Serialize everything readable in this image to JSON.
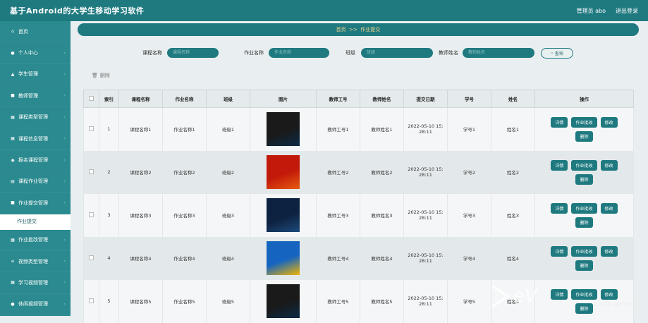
{
  "header": {
    "title": "基于Android的大学生移动学习软件",
    "user": "管理员 abo",
    "logout": "退出登录"
  },
  "sidebar": {
    "items": [
      {
        "label": "首页",
        "icon": "home-icon",
        "glyph": "⌂"
      },
      {
        "label": "个人中心",
        "icon": "user-icon",
        "glyph": "●"
      },
      {
        "label": "学生管理",
        "icon": "bank-icon",
        "glyph": "▲"
      },
      {
        "label": "教师管理",
        "icon": "doc-icon",
        "glyph": "■"
      },
      {
        "label": "课程类型管理",
        "icon": "grid-icon",
        "glyph": "▦"
      },
      {
        "label": "课程信息管理",
        "icon": "grid-icon",
        "glyph": "▦"
      },
      {
        "label": "报名课程管理",
        "icon": "disc-icon",
        "glyph": "◉"
      },
      {
        "label": "课程作业管理",
        "icon": "list-icon",
        "glyph": "▤"
      },
      {
        "label": "作业提交管理",
        "icon": "file-icon",
        "glyph": "■"
      },
      {
        "label": "作业提交",
        "sub": true
      },
      {
        "label": "作业批改管理",
        "icon": "grid-icon",
        "glyph": "▦"
      },
      {
        "label": "视频类型管理",
        "icon": "menu-icon",
        "glyph": "≡"
      },
      {
        "label": "学习视频管理",
        "icon": "grid-icon",
        "glyph": "▦"
      },
      {
        "label": "休闲视频管理",
        "icon": "user-icon",
        "glyph": "●"
      }
    ]
  },
  "breadcrumb": {
    "text": "首页  >>  作业提交"
  },
  "search": {
    "course_label": "课程名称",
    "course_ph": "课程名称",
    "hw_label": "作业名称",
    "hw_ph": "作业名称",
    "class_label": "班级",
    "class_ph": "班级",
    "teacher_label": "教师姓名",
    "teacher_ph": "教师姓名",
    "button": "查询"
  },
  "toolbar": {
    "delete": "删除"
  },
  "table": {
    "headers": [
      "索引",
      "课程名称",
      "作业名称",
      "班级",
      "图片",
      "教师工号",
      "教师姓名",
      "提交日期",
      "学号",
      "姓名",
      "操作"
    ],
    "rows": [
      {
        "idx": "1",
        "course": "课程名称1",
        "hw": "作业名称1",
        "cls": "班级1",
        "tno": "教师工号1",
        "tname": "教师姓名1",
        "date": "2022-05-10 15:\n28:11",
        "sno": "学号1",
        "sname": "姓名1",
        "img": "#1a1a1a",
        "img2": "#0b2a45"
      },
      {
        "idx": "2",
        "course": "课程名称2",
        "hw": "作业名称2",
        "cls": "班级2",
        "tno": "教师工号2",
        "tname": "教师姓名2",
        "date": "2022-05-10 15:\n28:11",
        "sno": "学号2",
        "sname": "姓名2",
        "img": "#c21a0a",
        "img2": "#e65a10"
      },
      {
        "idx": "3",
        "course": "课程名称3",
        "hw": "作业名称3",
        "cls": "班级3",
        "tno": "教师工号3",
        "tname": "教师姓名3",
        "date": "2022-05-10 15:\n28:11",
        "sno": "学号3",
        "sname": "姓名3",
        "img": "#0d2140",
        "img2": "#1d4a7a"
      },
      {
        "idx": "4",
        "course": "课程名称4",
        "hw": "作业名称4",
        "cls": "班级4",
        "tno": "教师工号4",
        "tname": "教师姓名4",
        "date": "2022-05-10 15:\n28:11",
        "sno": "学号4",
        "sname": "姓名4",
        "img": "#1565c0",
        "img2": "#f0b400"
      },
      {
        "idx": "5",
        "course": "课程名称5",
        "hw": "作业名称5",
        "cls": "班级5",
        "tno": "教师工号5",
        "tname": "教师姓名5",
        "date": "2022-05-10 15:\n28:11",
        "sno": "学号5",
        "sname": "姓名5",
        "img": "#1a1a1a",
        "img2": "#0b2a45"
      }
    ],
    "ops": [
      "详情",
      "作业批改",
      "修改",
      "删除"
    ]
  },
  "watermark": {
    "csdn": "CSDN @jinkin03"
  },
  "colors": {
    "primary": "#1f7a80",
    "accent": "#f3d28a"
  }
}
